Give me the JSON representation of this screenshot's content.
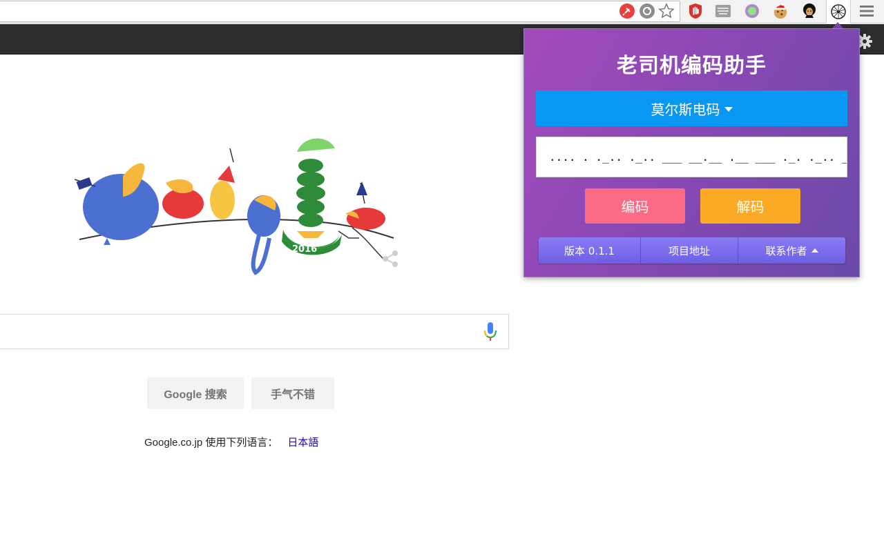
{
  "browser": {
    "toolbar_icons": [
      "red-plug-extension-icon",
      "sync-extension-icon",
      "bookmark-star-icon",
      "ublock-hand-icon",
      "keyboard-extension-icon",
      "purple-ring-extension-icon",
      "cookie-santa-extension-icon",
      "avatar-extension-icon",
      "coding-helper-extension-icon",
      "chrome-menu-icon"
    ]
  },
  "google": {
    "doodle_year": "2016",
    "search_button": "Google 搜索",
    "lucky_button": "手气不错",
    "language_prefix": "Google.co.jp 使用下列语言：",
    "language_link": "日本語"
  },
  "popup": {
    "title": "老司机编码助手",
    "mode_label": "莫尔斯电码",
    "text_value": ".... . ._.. ._.. ___ __.__ .__ ___ ._. ._.. _..",
    "encode_label": "编码",
    "decode_label": "解码",
    "footer": {
      "version": "版本 0.1.1",
      "project": "项目地址",
      "contact": "联系作者"
    }
  },
  "colors": {
    "popup_gradient_start": "#a24bbb",
    "popup_gradient_end": "#6a4aa8",
    "mode_select_bg": "#0898f2",
    "encode_bg": "#fb6b85",
    "decode_bg": "#fbaa25",
    "footer_bg": "#7a6df0"
  }
}
